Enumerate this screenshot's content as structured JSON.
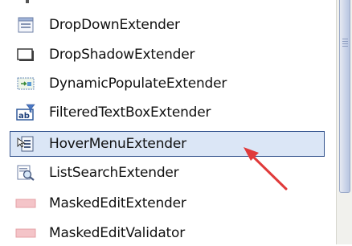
{
  "toolbox": {
    "items": [
      {
        "label": "DropDownExtender",
        "icon": "dropdown-extender-icon"
      },
      {
        "label": "DropShadowExtender",
        "icon": "dropshadow-extender-icon"
      },
      {
        "label": "DynamicPopulateExtender",
        "icon": "dynamic-populate-icon"
      },
      {
        "label": "FilteredTextBoxExtender",
        "icon": "filtered-textbox-icon"
      },
      {
        "label": "HoverMenuExtender",
        "icon": "hover-menu-icon"
      },
      {
        "label": "ListSearchExtender",
        "icon": "list-search-icon"
      },
      {
        "label": "MaskedEditExtender",
        "icon": "masked-edit-icon"
      },
      {
        "label": "MaskedEditValidator",
        "icon": "masked-validator-icon"
      }
    ],
    "selected_index": 4,
    "filtered_icon_text": "ab"
  },
  "colors": {
    "selection_fill": "#dbe6f6",
    "selection_border": "#33528d",
    "arrow": "#e03a3a"
  }
}
